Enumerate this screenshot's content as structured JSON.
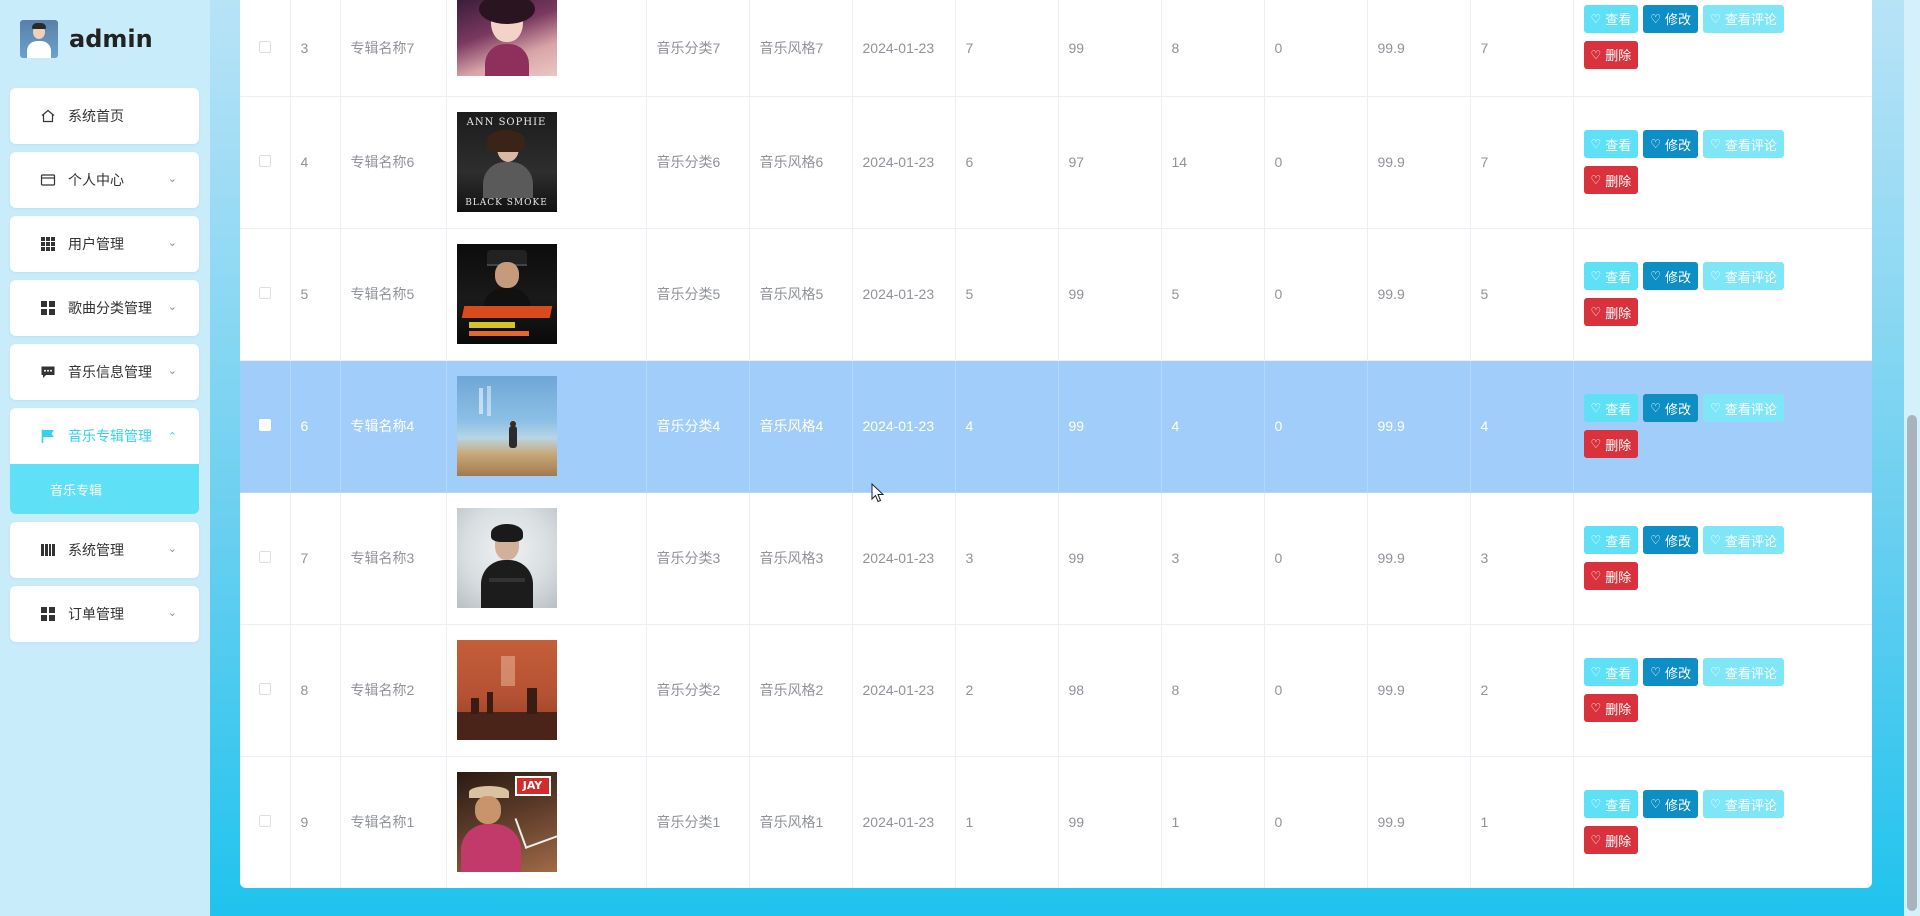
{
  "sidebar": {
    "username": "admin",
    "menu": [
      {
        "label": "系统首页",
        "icon": "home-icon",
        "expandable": false
      },
      {
        "label": "个人中心",
        "icon": "card-icon",
        "expandable": true
      },
      {
        "label": "用户管理",
        "icon": "grid-icon",
        "expandable": true
      },
      {
        "label": "歌曲分类管理",
        "icon": "apps-icon",
        "expandable": true
      },
      {
        "label": "音乐信息管理",
        "icon": "chat-icon",
        "expandable": true
      },
      {
        "label": "音乐专辑管理",
        "icon": "flag-icon",
        "expandable": true,
        "active": true
      },
      {
        "label": "系统管理",
        "icon": "book-icon",
        "expandable": true
      },
      {
        "label": "订单管理",
        "icon": "apps-icon",
        "expandable": true
      }
    ],
    "submenu": {
      "label": "音乐专辑"
    }
  },
  "actions": {
    "view": "查看",
    "edit": "修改",
    "review": "查看评论",
    "delete": "删除"
  },
  "table": {
    "rows": [
      {
        "index": "3",
        "name": "专辑名称7",
        "category": "音乐分类7",
        "style": "音乐风格7",
        "date": "2024-01-23",
        "c1": "7",
        "c2": "99",
        "c3": "8",
        "c4": "0",
        "c5": "99.9",
        "c6": "7",
        "cover_text": ""
      },
      {
        "index": "4",
        "name": "专辑名称6",
        "category": "音乐分类6",
        "style": "音乐风格6",
        "date": "2024-01-23",
        "c1": "6",
        "c2": "97",
        "c3": "14",
        "c4": "0",
        "c5": "99.9",
        "c6": "7",
        "cover_text": "ANN SOPHIE",
        "cover_text2": "BLACK SMOKE"
      },
      {
        "index": "5",
        "name": "专辑名称5",
        "category": "音乐分类5",
        "style": "音乐风格5",
        "date": "2024-01-23",
        "c1": "5",
        "c2": "99",
        "c3": "5",
        "c4": "0",
        "c5": "99.9",
        "c6": "5",
        "cover_text": ""
      },
      {
        "index": "6",
        "name": "专辑名称4",
        "category": "音乐分类4",
        "style": "音乐风格4",
        "date": "2024-01-23",
        "c1": "4",
        "c2": "99",
        "c3": "4",
        "c4": "0",
        "c5": "99.9",
        "c6": "4",
        "selected": true,
        "cover_text": ""
      },
      {
        "index": "7",
        "name": "专辑名称3",
        "category": "音乐分类3",
        "style": "音乐风格3",
        "date": "2024-01-23",
        "c1": "3",
        "c2": "99",
        "c3": "3",
        "c4": "0",
        "c5": "99.9",
        "c6": "3",
        "cover_text": ""
      },
      {
        "index": "8",
        "name": "专辑名称2",
        "category": "音乐分类2",
        "style": "音乐风格2",
        "date": "2024-01-23",
        "c1": "2",
        "c2": "98",
        "c3": "8",
        "c4": "0",
        "c5": "99.9",
        "c6": "2",
        "cover_text": ""
      },
      {
        "index": "9",
        "name": "专辑名称1",
        "category": "音乐分类1",
        "style": "音乐风格1",
        "date": "2024-01-23",
        "c1": "1",
        "c2": "99",
        "c3": "1",
        "c4": "0",
        "c5": "99.9",
        "c6": "1",
        "cover_text": "JAY"
      }
    ]
  },
  "colors": {
    "accent": "#5ee0f7",
    "edit": "#0d8ec4",
    "delete": "#d9323c",
    "selected_row": "#a1cdfa"
  }
}
